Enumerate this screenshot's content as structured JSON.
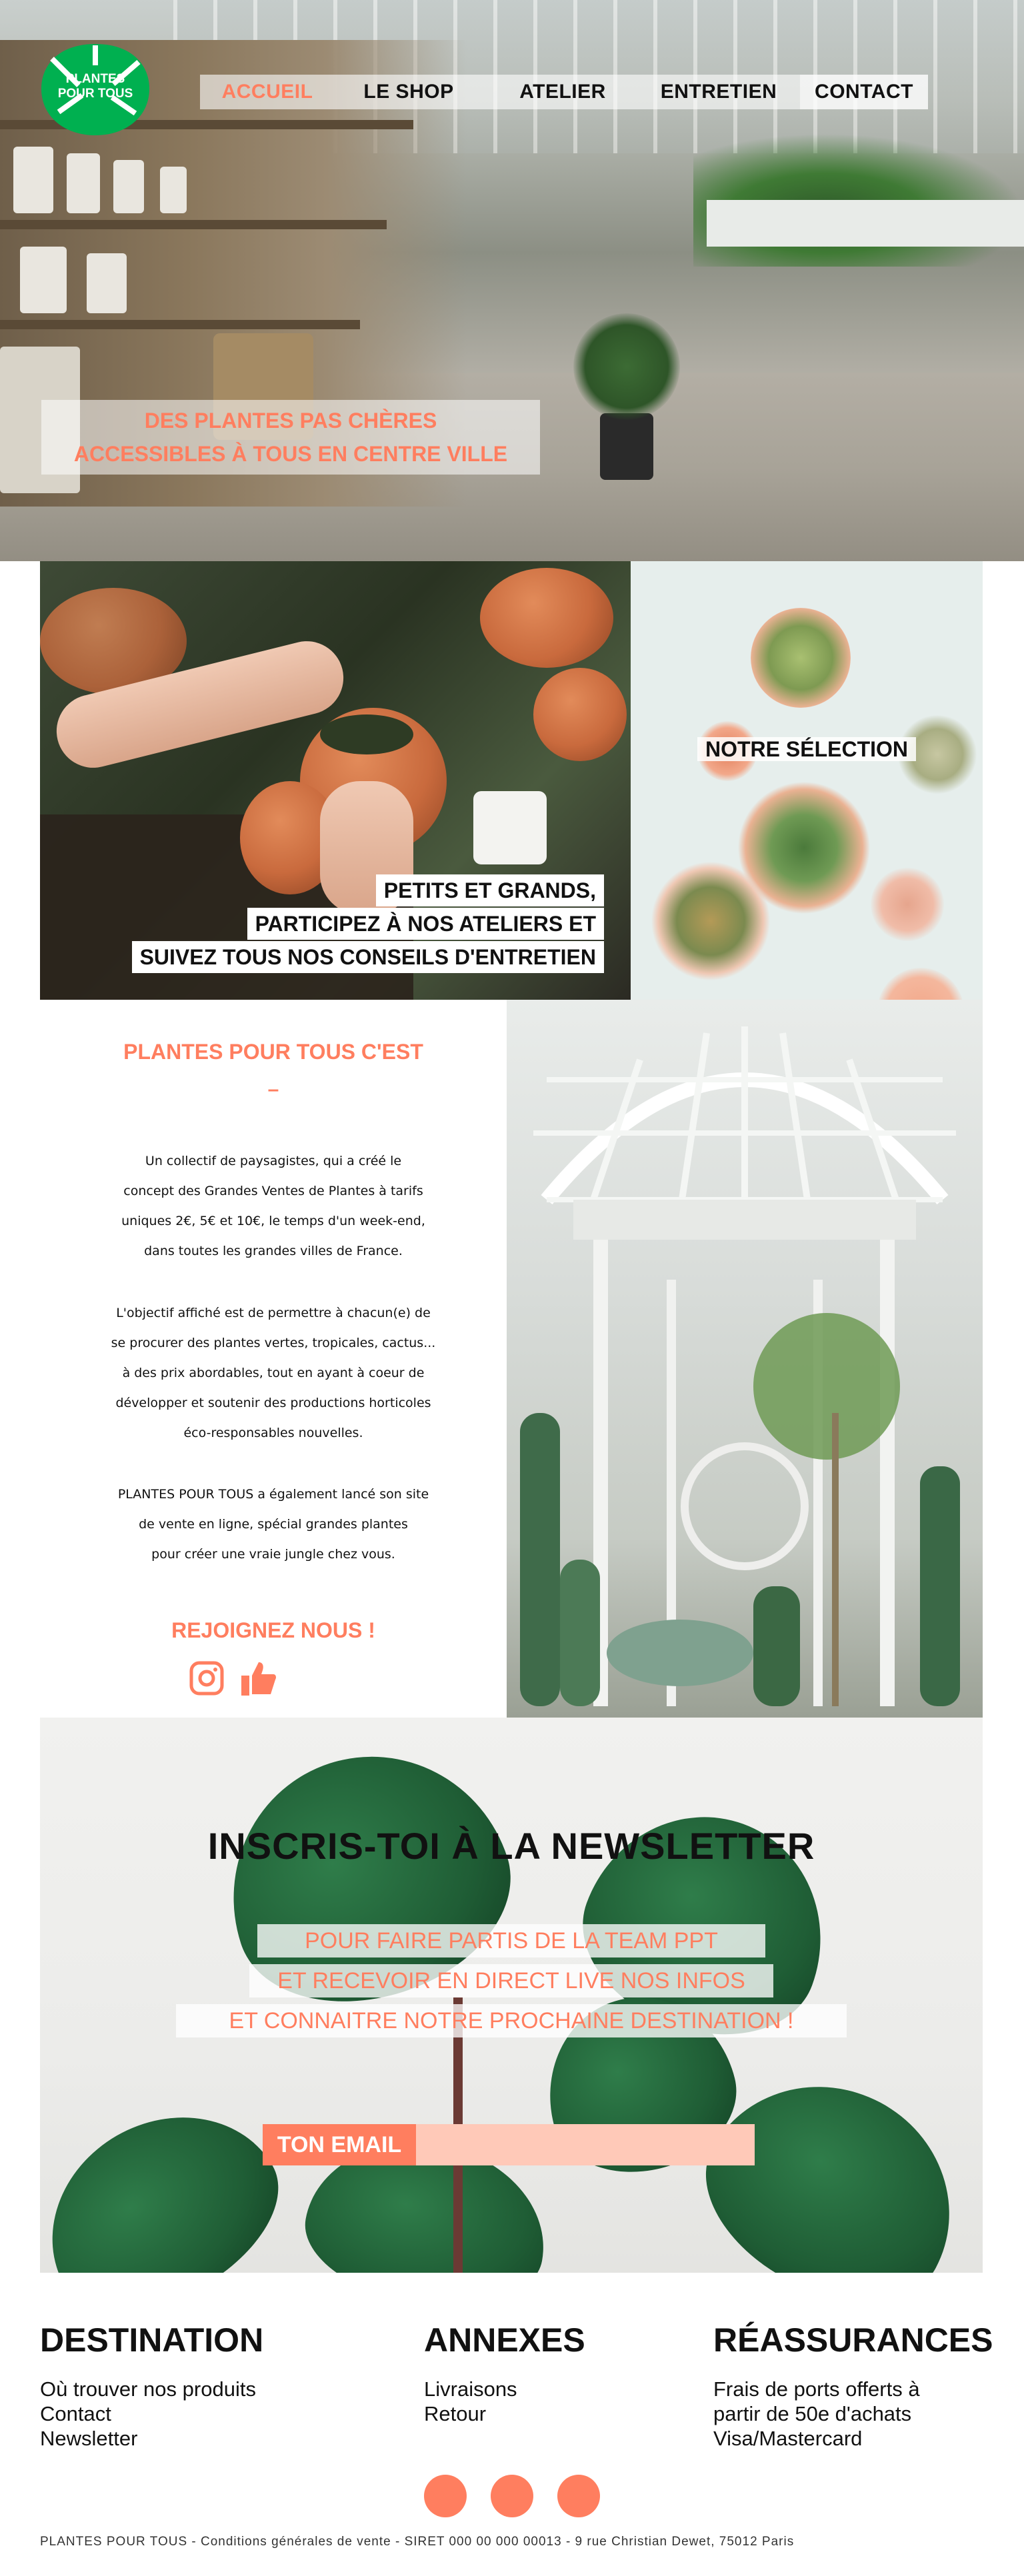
{
  "brand": {
    "logo_line1": "PLANTES",
    "logo_line2": "POUR TOUS",
    "logo_color": "#00b050"
  },
  "colors": {
    "accent": "#ff7e5f",
    "accent_light": "#ffc9b8",
    "text": "#111111"
  },
  "nav": {
    "items": [
      {
        "label": "ACCUEIL",
        "active": true
      },
      {
        "label": "LE SHOP",
        "active": false
      },
      {
        "label": "ATELIER",
        "active": false
      },
      {
        "label": "ENTRETIEN",
        "active": false
      },
      {
        "label": "CONTACT",
        "active": false
      }
    ]
  },
  "hero": {
    "tagline_line1": "DES PLANTES PAS CHÈRES",
    "tagline_line2": "ACCESSIBLES À TOUS EN CENTRE VILLE"
  },
  "atelier": {
    "line1": "PETITS ET GRANDS,",
    "line2": "PARTICIPEZ À NOS ATELIERS ET",
    "line3": "SUIVEZ TOUS NOS CONSEILS D'ENTRETIEN"
  },
  "selection": {
    "label": "NOTRE SÉLECTION"
  },
  "about": {
    "title": "PLANTES POUR TOUS C'EST",
    "dash": "–",
    "paragraph1": "Un collectif de paysagistes, qui a créé le\nconcept des Grandes Ventes de Plantes à tarifs\nuniques 2€, 5€ et 10€, le temps d'un week-end,\ndans toutes les grandes villes de France.",
    "paragraph2": "L'objectif affiché est de permettre à chacun(e) de\nse procurer des plantes vertes, tropicales, cactus...\nà des prix abordables, tout en ayant à coeur de\ndévelopper et soutenir des productions horticoles\néco-responsables nouvelles.",
    "paragraph3": "PLANTES POUR TOUS a également lancé son site\nde vente en ligne, spécial grandes plantes\npour créer une vraie jungle chez vous.",
    "join": "REJOIGNEZ NOUS !",
    "social_icons": [
      "instagram-icon",
      "thumbs-up-icon"
    ]
  },
  "newsletter": {
    "title": "INSCRIS-TOI À LA NEWSLETTER",
    "line1": "POUR FAIRE PARTIS DE LA TEAM PPT",
    "line2": "ET RECEVOIR EN DIRECT LIVE NOS INFOS",
    "line3": "ET CONNAITRE NOTRE PROCHAINE DESTINATION !",
    "email_label": "TON EMAIL",
    "email_value": ""
  },
  "footer": {
    "destination": {
      "title": "DESTINATION",
      "items": [
        "Où trouver nos produits",
        "Contact",
        "Newsletter"
      ]
    },
    "annexes": {
      "title": "ANNEXES",
      "items": [
        "Livraisons",
        "Retour"
      ]
    },
    "reassurances": {
      "title": "RÉASSURANCES",
      "items": [
        "Frais de ports offerts à",
        "partir de 50e d'achats",
        "Visa/Mastercard"
      ]
    },
    "legal": "PLANTES POUR TOUS - Conditions générales de vente - SIRET 000 00 000 00013 - 9 rue Christian Dewet, 75012 Paris"
  }
}
